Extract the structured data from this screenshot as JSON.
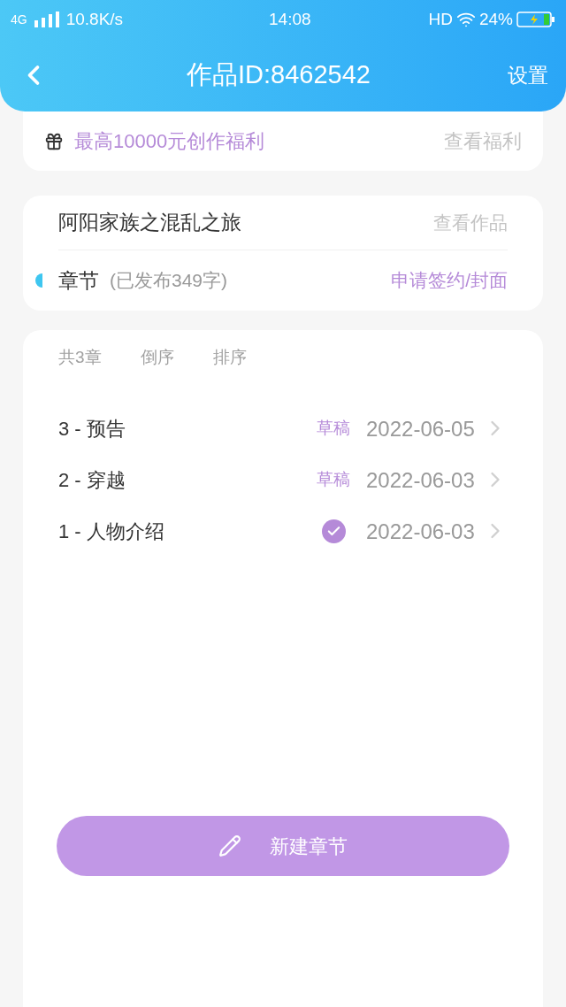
{
  "status_bar": {
    "network": "4G",
    "speed": "10.8K/s",
    "time": "14:08",
    "hd": "HD",
    "battery": "24%"
  },
  "header": {
    "title": "作品ID:8462542",
    "action": "设置"
  },
  "benefit": {
    "text": "最高10000元创作福利",
    "link": "查看福利"
  },
  "work": {
    "title": "阿阳家族之混乱之旅",
    "link": "查看作品",
    "section": "章节",
    "published": "(已发布349字)",
    "action": "申请签约/封面"
  },
  "toolbar": {
    "count": "共3章",
    "items": [
      "倒序",
      "排序"
    ]
  },
  "chapters": [
    {
      "title": "3 - 预告",
      "kind": "draft",
      "status": "草稿",
      "date": "2022-06-05"
    },
    {
      "title": "2 - 穿越",
      "kind": "draft",
      "status": "草稿",
      "date": "2022-06-03"
    },
    {
      "title": "1 - 人物介绍",
      "kind": "published",
      "date": "2022-06-03"
    }
  ],
  "new_button": "新建章节"
}
